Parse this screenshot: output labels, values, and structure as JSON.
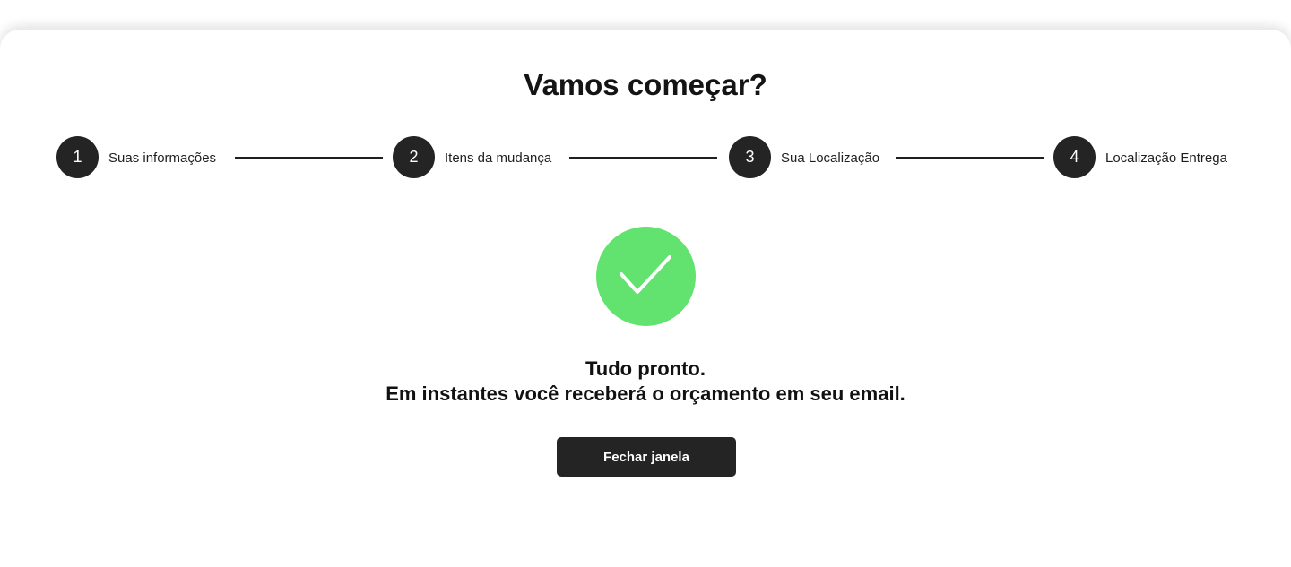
{
  "modal": {
    "title": "Vamos começar?"
  },
  "stepper": {
    "steps": [
      {
        "number": "1",
        "label": "Suas informações"
      },
      {
        "number": "2",
        "label": "Itens da mudança"
      },
      {
        "number": "3",
        "label": "Sua Localização"
      },
      {
        "number": "4",
        "label": "Localização Entrega"
      }
    ]
  },
  "success": {
    "icon": "checkmark-icon",
    "icon_color": "#62e26e",
    "line1": "Tudo pronto.",
    "line2": "Em instantes você receberá o orçamento em seu email."
  },
  "actions": {
    "close_label": "Fechar janela"
  },
  "colors": {
    "accent_dark": "#242424",
    "success_green": "#62e26e"
  }
}
